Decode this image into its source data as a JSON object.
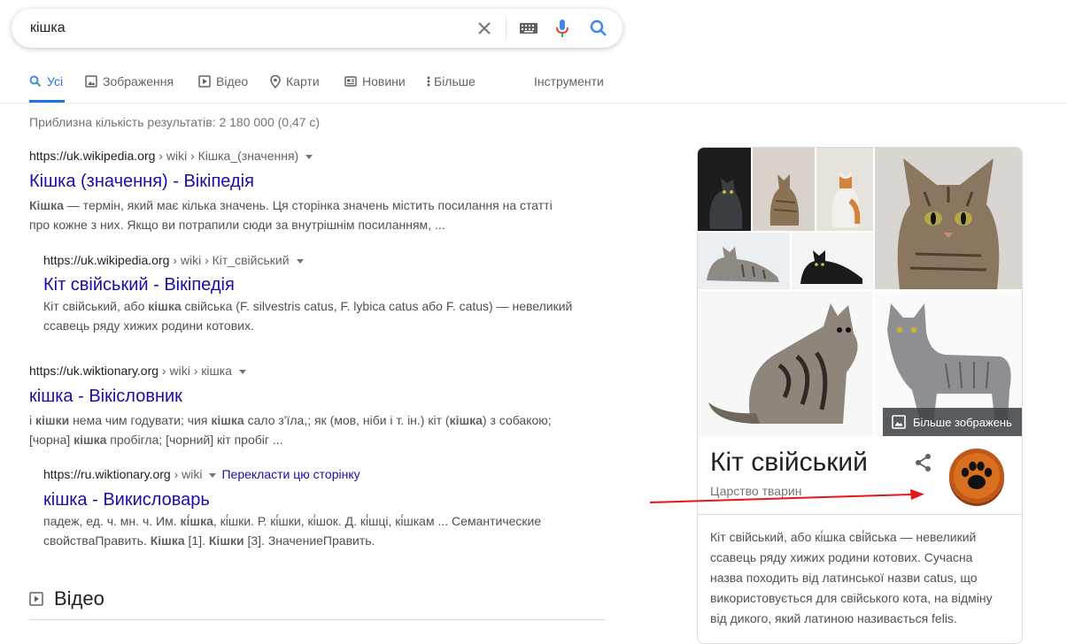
{
  "search": {
    "query": "кішка"
  },
  "tabs": [
    {
      "label": "Усі",
      "active": true
    },
    {
      "label": "Зображення"
    },
    {
      "label": "Відео"
    },
    {
      "label": "Карти"
    },
    {
      "label": "Новини"
    },
    {
      "label": "Більше"
    },
    {
      "label": "Інструменти"
    }
  ],
  "stats": "Приблизна кількість результатів: 2 180 000 (0,47 с)",
  "results": [
    {
      "domain": "https://uk.wikipedia.org",
      "path": " › wiki › Кішка_(значення)",
      "title": "Кішка (значення) - Вікіпедія",
      "snippet": [
        {
          "b": "Кішка"
        },
        {
          "t": " — термін, який має кілька значень. Ця сторінка значень містить посилання на статті про кожне з них. Якщо ви потрапили сюди за внутрішнім посиланням, ..."
        }
      ]
    },
    {
      "domain": "https://uk.wikipedia.org",
      "path": " › wiki › Кіт_свійський",
      "title": "Кіт свійський - Вікіпедія",
      "snippet": [
        {
          "t": "Кіт свійський, або "
        },
        {
          "b": "кішка"
        },
        {
          "t": " свійська (F. silvestris catus, F. lybica catus або F. catus) — невеликий ссавець ряду хижих родини котових."
        }
      ]
    },
    {
      "domain": "https://uk.wiktionary.org",
      "path": " › wiki › кішка",
      "title": "кішка - Вікісловник",
      "snippet": [
        {
          "t": "і "
        },
        {
          "b": "кішки"
        },
        {
          "t": " нема чим годувати; чия "
        },
        {
          "b": "кішка"
        },
        {
          "t": " сало з'їла,; як (мов, ніби і т. ін.) кіт ("
        },
        {
          "b": "кішка"
        },
        {
          "t": ") з собакою; [чорна] "
        },
        {
          "b": "кішка"
        },
        {
          "t": " пробігла; [чорний] кіт пробіг ..."
        }
      ]
    },
    {
      "domain": "https://ru.wiktionary.org",
      "path": " › wiki",
      "translate": "Перекласти цю сторінку",
      "title": "кішка - Викисловарь",
      "snippet": [
        {
          "t": "падеж, ед. ч. мн. ч. Им. "
        },
        {
          "b": "кі́шка"
        },
        {
          "t": ", кі́шки. Р. кі́шки, кі́шок. Д. кі́шці, кі́шкам ... Семантические свойстваПравить. "
        },
        {
          "b": "Кішка"
        },
        {
          "t": " [1]. "
        },
        {
          "b": "Кішки"
        },
        {
          "t": " [3]. ЗначениеПравить."
        }
      ]
    }
  ],
  "video_section": {
    "title": "Відео"
  },
  "knowledge_panel": {
    "more_images": "Більше зображень",
    "title": "Кіт свійський",
    "subtitle": "Царство тварин",
    "description": "Кіт свійський, або кі́шка сві́йська — невеликий ссавець ряду хижих родини котових. Сучасна назва походить від латинської назви catus, що використовується для свійського кота, на відміну від дикого, який латиною називається felis."
  },
  "colors": {
    "link": "#1a0dab",
    "accent": "#1a73e8",
    "annotation_arrow": "#e8141b",
    "paw_badge": "#c1581a"
  }
}
